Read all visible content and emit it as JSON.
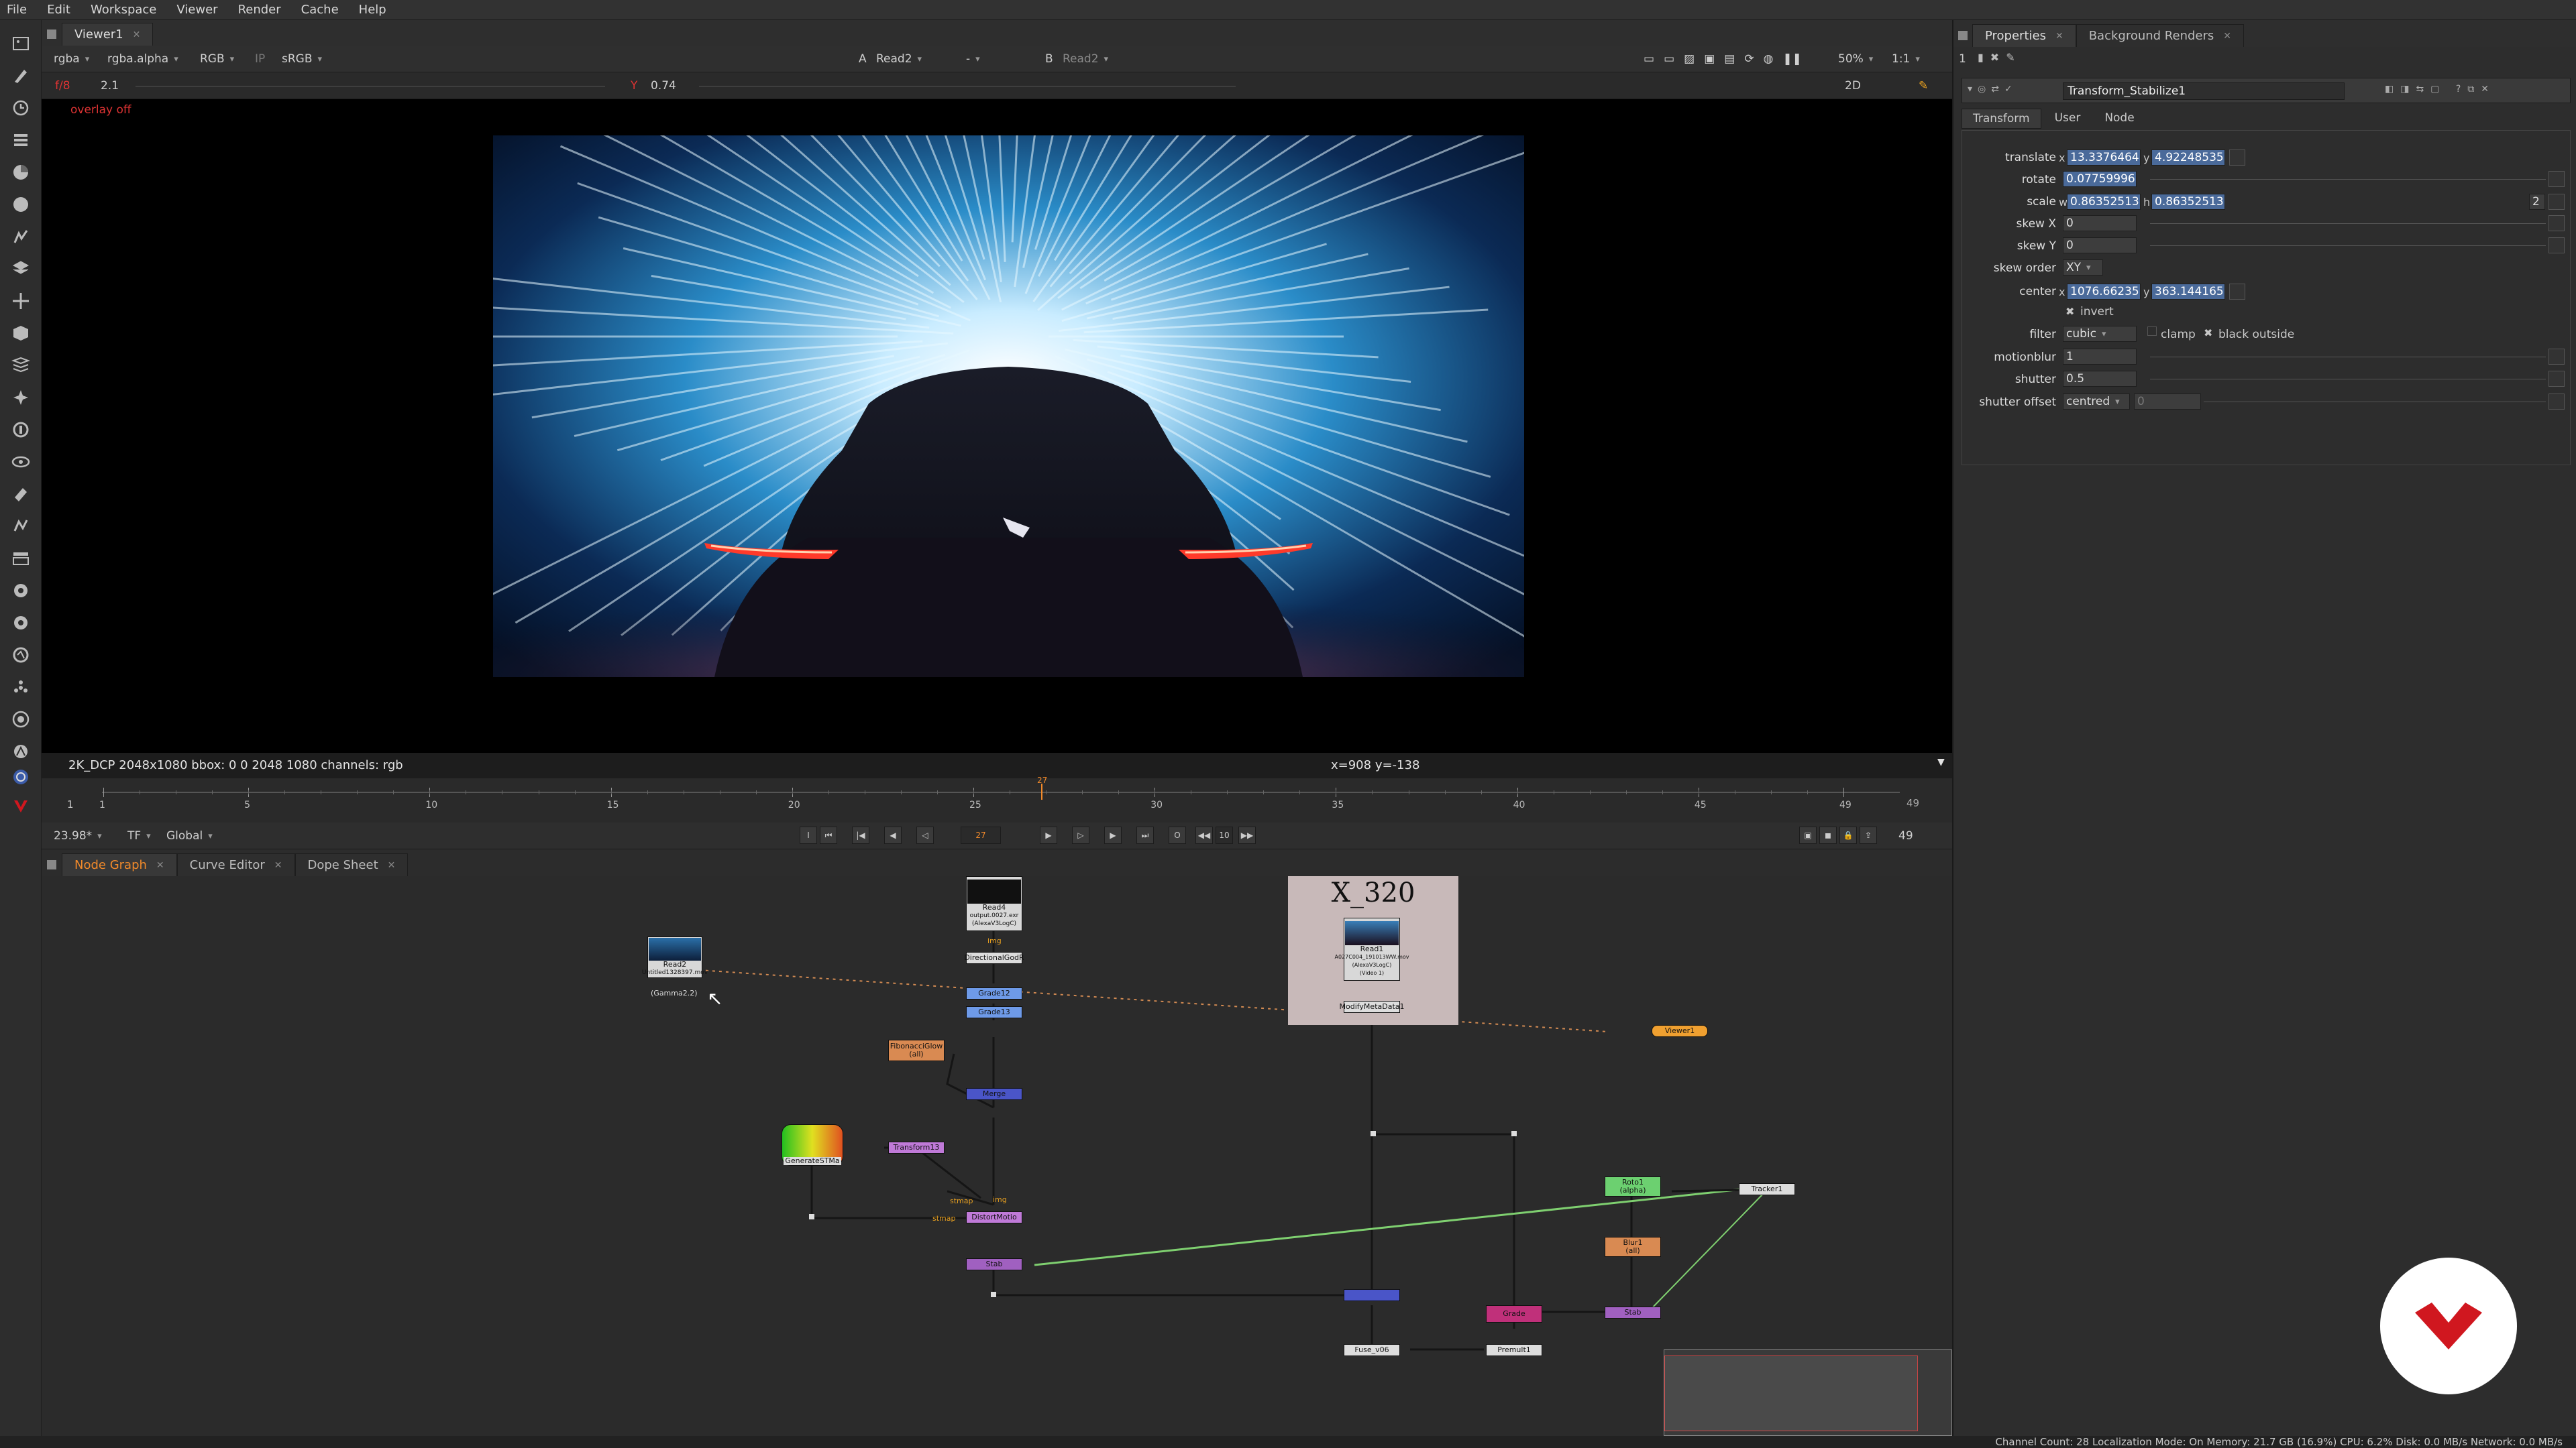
{
  "menubar": {
    "items": [
      "File",
      "Edit",
      "Workspace",
      "Viewer",
      "Render",
      "Cache",
      "Help"
    ]
  },
  "toolbar": {
    "icons": [
      "image-icon",
      "draw-icon",
      "time-icon",
      "channel-icon",
      "color-icon",
      "filter-icon",
      "keyer-icon",
      "merge-icon",
      "transform-icon",
      "3d-icon",
      "views-icon",
      "metadata-icon",
      "toolsets-icon",
      "other-icon",
      "furnace-icon",
      "ocula-icon",
      "cara-vr-icon",
      "particles-icon",
      "deep-icon",
      "modeler-icon",
      "generate-icon",
      "smart-vector-icon",
      "copycat-icon"
    ]
  },
  "viewer": {
    "tab": "Viewer1",
    "channels": "rgba",
    "alpha": "rgba.alpha",
    "rgb": "RGB",
    "ip": "IP",
    "colorspace": "sRGB",
    "input_a_label": "A",
    "input_a": "Read2",
    "merge_op": "-",
    "input_b_label": "B",
    "input_b": "Read2",
    "zoom": "50%",
    "proxy": "1:1",
    "mode": "2D",
    "fstop": "f/8",
    "gamma": "2.1",
    "gain_label": "Y",
    "gain": "0.74",
    "overlay": "overlay off",
    "format_info": "2K_DCP 2048x1080  bbox: 0 0 2048 1080 channels: rgb",
    "coords": "x=908 y=-138"
  },
  "timeline": {
    "start": "1",
    "end": "49",
    "current": "27",
    "ticks": [
      "1",
      "5",
      "10",
      "15",
      "20",
      "25",
      "30",
      "35",
      "40",
      "45",
      "49"
    ],
    "fps": "23.98*",
    "tf": "TF",
    "range_mode": "Global",
    "frame_field": "27",
    "increment": "10",
    "end_field": "49"
  },
  "graph_tabs": [
    {
      "label": "Node Graph",
      "active": true
    },
    {
      "label": "Curve Editor",
      "active": false
    },
    {
      "label": "Dope Sheet",
      "active": false
    }
  ],
  "nodes": {
    "read2": "Read2",
    "read2_sub": "Untitled1328397.mov",
    "read2_gamma": "(Gamma2.2)",
    "read4": "Read4",
    "read4_sub": "output.0027.exr",
    "read4_sub2": "(AlexaV3LogC)",
    "img": "img",
    "directional_god": "DirectionalGodR",
    "grade12": "Grade12",
    "grade13": "Grade13",
    "fibonacci": "FibonacciGlow",
    "fibonacci_all": "(all)",
    "merge": "Merge",
    "generate_stmap": "GenerateSTMa",
    "transform13": "Transform13",
    "stmap": "stmap",
    "stmap2": "stmap",
    "img2": "img",
    "distort": "DistortMotio",
    "stab": "Stab",
    "backdrop_label": "X_320",
    "read1": "Read1",
    "read1_sub": "A027C004_191013WW.mov",
    "read1_sub2": "(AlexaV3LogC)",
    "read1_sub3": "(Video 1)",
    "modify_meta": "ModifyMetaData1",
    "viewer1": "Viewer1",
    "roto1": "Roto1",
    "roto1_sub": "(alpha)",
    "blur1": "Blur1",
    "blur1_sub": "(all)",
    "tracker1": "Tracker1",
    "stab2": "Stab",
    "fuse": "Fuse_v06",
    "premult": "Premult1",
    "grade_pink": "Grade"
  },
  "properties": {
    "tabs": [
      "Properties",
      "Background Renders"
    ],
    "panel_count": "1",
    "node_name": "Transform_Stabilize1",
    "subtabs": [
      "Transform",
      "User",
      "Node"
    ],
    "knobs": {
      "translate_label": "translate",
      "translate_x_axis": "x",
      "translate_x": "13.3376464",
      "translate_y_axis": "y",
      "translate_y": "4.92248535",
      "rotate_label": "rotate",
      "rotate": "0.07759996",
      "scale_label": "scale",
      "scale_w_axis": "w",
      "scale_w": "0.86352513",
      "scale_h_axis": "h",
      "scale_h": "0.86352513",
      "scale_count": "2",
      "skewx_label": "skew X",
      "skewx": "0",
      "skewy_label": "skew Y",
      "skewy": "0",
      "skew_order_label": "skew order",
      "skew_order": "XY",
      "center_label": "center",
      "center_x_axis": "x",
      "center_x": "1076.66235",
      "center_y_axis": "y",
      "center_y": "363.144165",
      "invert_label": "invert",
      "filter_label": "filter",
      "filter": "cubic",
      "clamp_label": "clamp",
      "black_outside_label": "black outside",
      "motionblur_label": "motionblur",
      "motionblur": "1",
      "shutter_label": "shutter",
      "shutter": "0.5",
      "shutter_offset_label": "shutter offset",
      "shutter_offset": "centred",
      "shutter_offset_val": "0"
    },
    "invert": true,
    "clamp": false,
    "black_outside": true
  },
  "status": "Channel Count: 28  Localization Mode: On  Memory: 21.7 GB (16.9%)  CPU: 6.2%  Disk: 0.0 MB/s  Network: 0.0 MB/s",
  "colors": {
    "accent": "#f28a2a",
    "logo": "#d0171f",
    "selection": "#4a6a9a"
  }
}
